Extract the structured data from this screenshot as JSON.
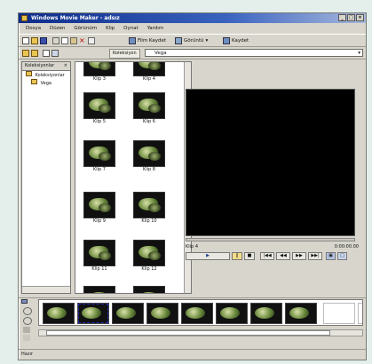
{
  "window": {
    "title": "Windows Movie Maker - adsız"
  },
  "menubar": [
    "Dosya",
    "Düzen",
    "Görünüm",
    "Klip",
    "Oynat",
    "Yardım"
  ],
  "toolbar": {
    "record_label": "Film Kaydet",
    "view_label": "Görüntü",
    "save_label": "Kaydet"
  },
  "toolbar2": {
    "collection_label": "Koleksiyon",
    "address_value": "Vega"
  },
  "tree": {
    "header": "Koleksiyonlar",
    "root": "Koleksiyonlar",
    "child": "Vega"
  },
  "clips": [
    "Klip 3",
    "Klip 4",
    "Klip 5",
    "Klip 6",
    "Klip 7",
    "Klip 8",
    "Klip 9",
    "Klip 10",
    "Klip 11",
    "Klip 12"
  ],
  "preview": {
    "clip_label": "Klip 4",
    "time": "0:00:00.00",
    "seek_progress": 0.0
  },
  "status": {
    "text": "Hazır"
  },
  "colors": {
    "accent": "#e5d41a",
    "title_start": "#0d2c8a",
    "title_end": "#a9b9dd"
  }
}
